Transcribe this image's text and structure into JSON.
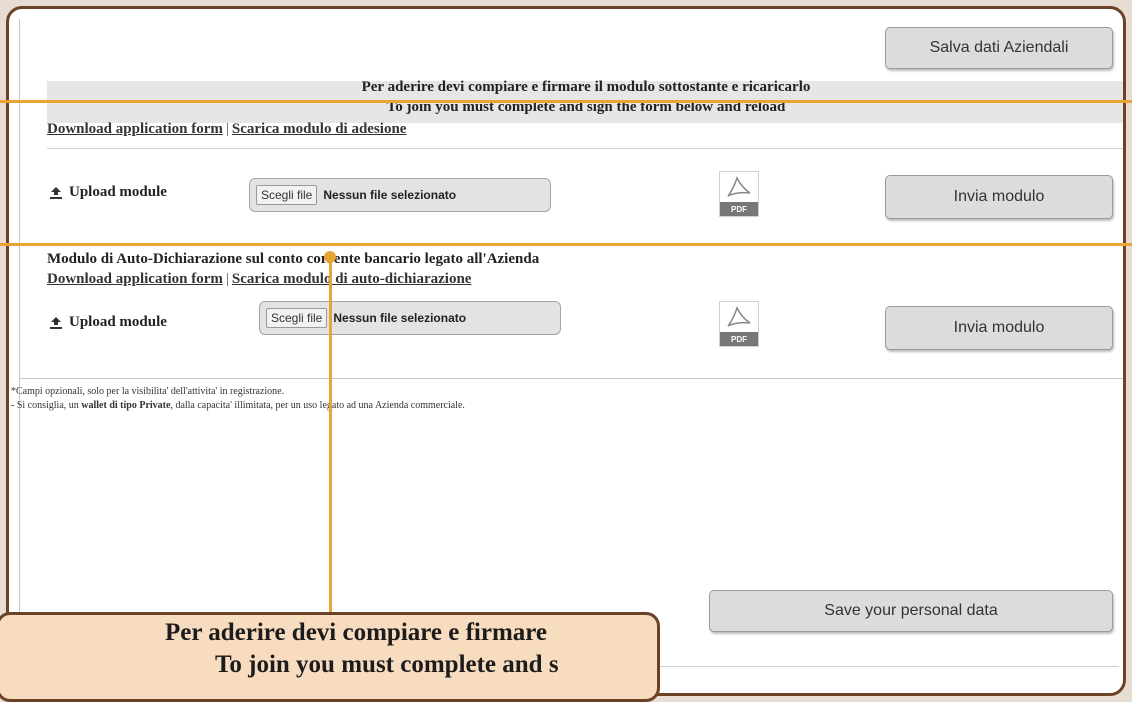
{
  "buttons": {
    "save_company": "Salva dati Aziendali",
    "send_module_1": "Invia modulo",
    "send_module_2": "Invia modulo",
    "save_personal": "Save your personal data"
  },
  "header": {
    "line1": "Per aderire devi compiare e firmare il modulo sottostante e ricaricarlo",
    "line2": "To join you must complete and sign the form below and reload"
  },
  "section1": {
    "download_en": "Download application form",
    "separator": "|",
    "download_it": "Scarica modulo di adesione",
    "upload_label": "Upload module",
    "file_button": "Scegli file",
    "file_status": "Nessun file selezionato",
    "pdf_label": "PDF"
  },
  "section2": {
    "title": "Modulo di Auto-Dichiarazione sul conto corrente bancario legato all'Azienda",
    "download_en": "Download application form",
    "separator": "|",
    "download_it": "Scarica modulo di auto-dichiarazione",
    "upload_label": "Upload module",
    "file_button": "Scegli file",
    "file_status": "Nessun file selezionato",
    "pdf_label": "PDF"
  },
  "notes": {
    "line1": "*Campi opzionali, solo per la visibilita' dell'attivita' in registrazione.",
    "line2_pre": "- Si consiglia, un ",
    "line2_bold": "wallet di tipo Private",
    "line2_post": ", dalla capacita' illimitata, per un uso legato ad una Azienda commerciale."
  },
  "callout": {
    "line1": "Per aderire devi compiare e firmare",
    "line2": "To join you must complete and s"
  },
  "colors": {
    "accent": "#e8a535",
    "frame": "#6b4226",
    "callout_bg": "#f7dcbf"
  },
  "icons": [
    "upload-icon",
    "pdf-icon"
  ]
}
